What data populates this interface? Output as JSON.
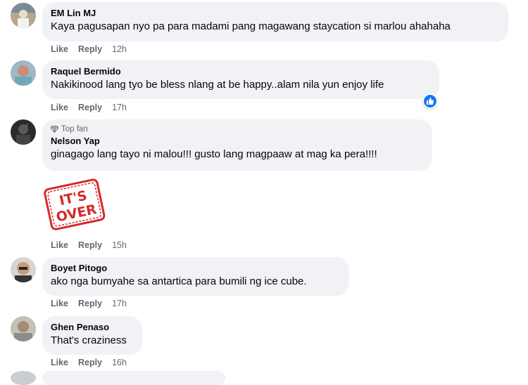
{
  "comments": [
    {
      "name": "EM Lin MJ",
      "text": "Kaya pagusapan nyo pa para madami pang magawang staycation si marlou ahahaha",
      "like": "Like",
      "reply": "Reply",
      "time": "12h"
    },
    {
      "name": "Raquel Bermido",
      "text": "Nakikinood lang tyo be bless nlang at be happy..alam nila yun enjoy life",
      "like": "Like",
      "reply": "Reply",
      "time": "17h"
    },
    {
      "badge": "Top fan",
      "name": "Nelson Yap",
      "text": "ginagago lang tayo ni malou!!! gusto lang magpaaw at mag ka pera!!!!",
      "like": "Like",
      "reply": "Reply",
      "time": "15h",
      "sticker_text_top": "IT'S",
      "sticker_text_bottom": "OVER"
    },
    {
      "name": "Boyet Pitogo",
      "text": "ako nga bumyahe sa antartica para bumili ng ice cube.",
      "like": "Like",
      "reply": "Reply",
      "time": "17h"
    },
    {
      "name": "Ghen Penaso",
      "text": "That's craziness",
      "like": "Like",
      "reply": "Reply",
      "time": "16h"
    }
  ],
  "colors": {
    "bubble": "#f0f2f5",
    "meta": "#65676b",
    "like_blue": "#1877f2",
    "sticker_red": "#d32a2a"
  }
}
